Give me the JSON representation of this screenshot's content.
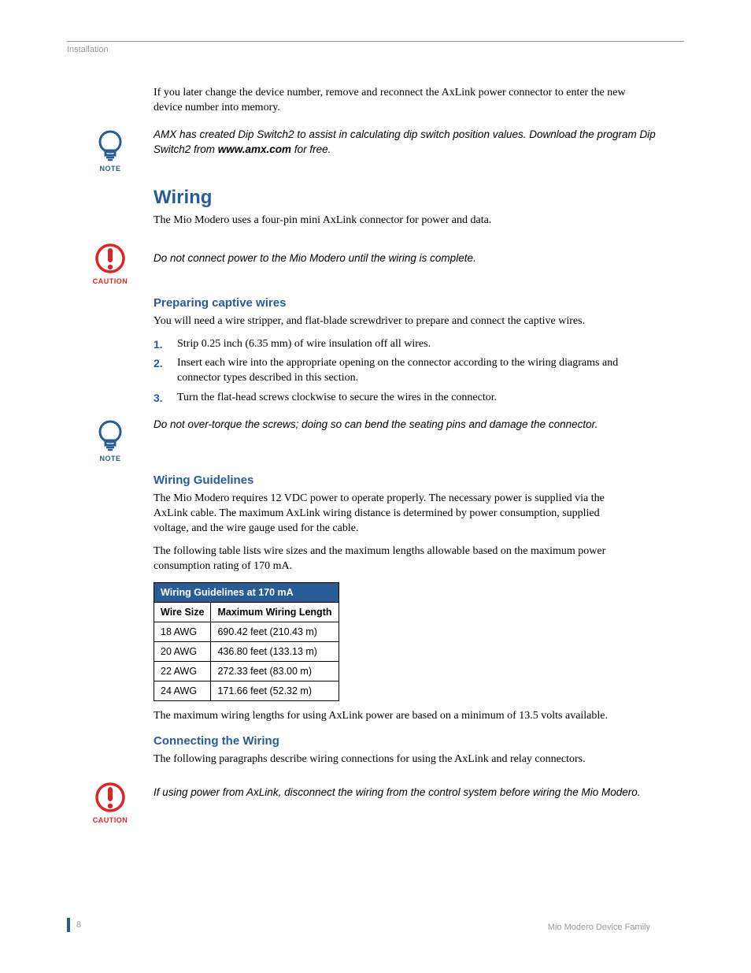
{
  "header": {
    "section": "Installation"
  },
  "intro": {
    "para1": "If you later change the device number, remove and reconnect the AxLink power connector to enter the new device number into memory."
  },
  "note1": {
    "line1": "AMX has created Dip Switch2 to assist in calculating dip switch position values. Download the program Dip Switch2 from ",
    "bold": "www.amx.com",
    "line2": " for free.",
    "label": "NOTE"
  },
  "wiring": {
    "heading": "Wiring",
    "intro": "The Mio Modero uses a four-pin mini AxLink connector for power and data."
  },
  "caution1": {
    "text": "Do not connect power to the Mio Modero until the wiring is complete.",
    "label": "CAUTION"
  },
  "preparing": {
    "heading": "Preparing captive wires",
    "intro": "You will need a wire stripper, and flat-blade screwdriver to prepare and connect the captive wires.",
    "steps": [
      "Strip 0.25 inch (6.35 mm) of wire insulation off all wires.",
      "Insert each wire into the appropriate opening on the connector according to the wiring diagrams and connector types described in this section.",
      "Turn the flat-head screws clockwise to secure the wires in the connector."
    ]
  },
  "note2": {
    "text": "Do not over-torque the screws; doing so can bend the seating pins and damage the connector.",
    "label": "NOTE"
  },
  "guidelines": {
    "heading": "Wiring Guidelines",
    "p1": "The Mio Modero requires 12 VDC power to operate properly. The necessary power is supplied via the AxLink cable. The maximum AxLink wiring distance is determined by power consumption, supplied voltage, and the wire gauge used for the cable.",
    "p2": "The following table lists wire sizes and the maximum lengths allowable based on the maximum power consumption rating of 170 mA.",
    "table": {
      "title": "Wiring Guidelines at 170 mA",
      "col1": "Wire Size",
      "col2": "Maximum Wiring Length",
      "rows": [
        {
          "size": "18 AWG",
          "len": "690.42 feet (210.43 m)"
        },
        {
          "size": "20 AWG",
          "len": "436.80 feet (133.13 m)"
        },
        {
          "size": "22 AWG",
          "len": "272.33 feet (83.00 m)"
        },
        {
          "size": "24 AWG",
          "len": "171.66 feet (52.32 m)"
        }
      ]
    },
    "p3": "The maximum wiring lengths for using AxLink power are based on a minimum of 13.5 volts available."
  },
  "connecting": {
    "heading": "Connecting the Wiring",
    "p1": "The following paragraphs describe wiring connections for using the AxLink and relay connectors."
  },
  "caution2": {
    "text": "If using power from AxLink, disconnect the wiring from the control system before wiring the Mio Modero.",
    "label": "CAUTION"
  },
  "footer": {
    "page": "8",
    "title": "Mio Modero Device Family"
  }
}
